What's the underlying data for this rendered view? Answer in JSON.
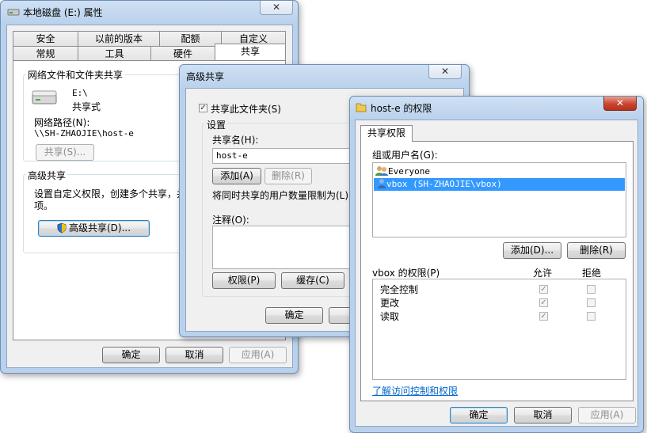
{
  "props_window": {
    "title": "本地磁盘 (E:) 属性",
    "close": "✕",
    "tabs_row1": [
      "安全",
      "以前的版本",
      "配额",
      "自定义"
    ],
    "tabs_row2": [
      "常规",
      "工具",
      "硬件",
      "共享"
    ],
    "share_group": {
      "label": "网络文件和文件夹共享",
      "drive": "E:\\",
      "status": "共享式",
      "path_label": "网络路径(N):",
      "path": "\\\\SH-ZHAOJIE\\host-e",
      "share_button": "共享(S)..."
    },
    "adv_group": {
      "label": "高级共享",
      "desc_line1": "设置自定义权限，创建多个共享，并",
      "desc_line2": "项。",
      "adv_button": "高级共享(D)..."
    },
    "ok": "确定",
    "cancel": "取消",
    "apply": "应用(A)"
  },
  "adv_window": {
    "title": "高级共享",
    "close": "✕",
    "share_checkbox": "共享此文件夹(S)",
    "settings_label": "设置",
    "share_name_label": "共享名(H):",
    "share_name_value": "host-e",
    "add": "添加(A)",
    "remove": "删除(R)",
    "limit_text": "将同时共享的用户数量限制为(L)",
    "comment_label": "注释(O):",
    "permissions": "权限(P)",
    "caching": "缓存(C)",
    "ok": "确定",
    "cancel_partial": "工"
  },
  "perm_window": {
    "title": "host-e 的权限",
    "close": "✕",
    "tab": "共享权限",
    "group_label": "组或用户名(G):",
    "users": [
      {
        "name": "Everyone",
        "selected": false
      },
      {
        "name": "vbox (SH-ZHAOJIE\\vbox)",
        "selected": true
      }
    ],
    "add": "添加(D)...",
    "remove": "删除(R)",
    "perm_label": "vbox 的权限(P)",
    "allow": "允许",
    "deny": "拒绝",
    "permissions": [
      {
        "name": "完全控制",
        "allow": true,
        "deny": false
      },
      {
        "name": "更改",
        "allow": true,
        "deny": false
      },
      {
        "name": "读取",
        "allow": true,
        "deny": false
      }
    ],
    "help_link": "了解访问控制和权限",
    "ok": "确定",
    "cancel": "取消",
    "apply": "应用(A)"
  },
  "colors": {
    "selection": "#3399ff",
    "link": "#0066cc",
    "frame": "#b9d1ec"
  }
}
